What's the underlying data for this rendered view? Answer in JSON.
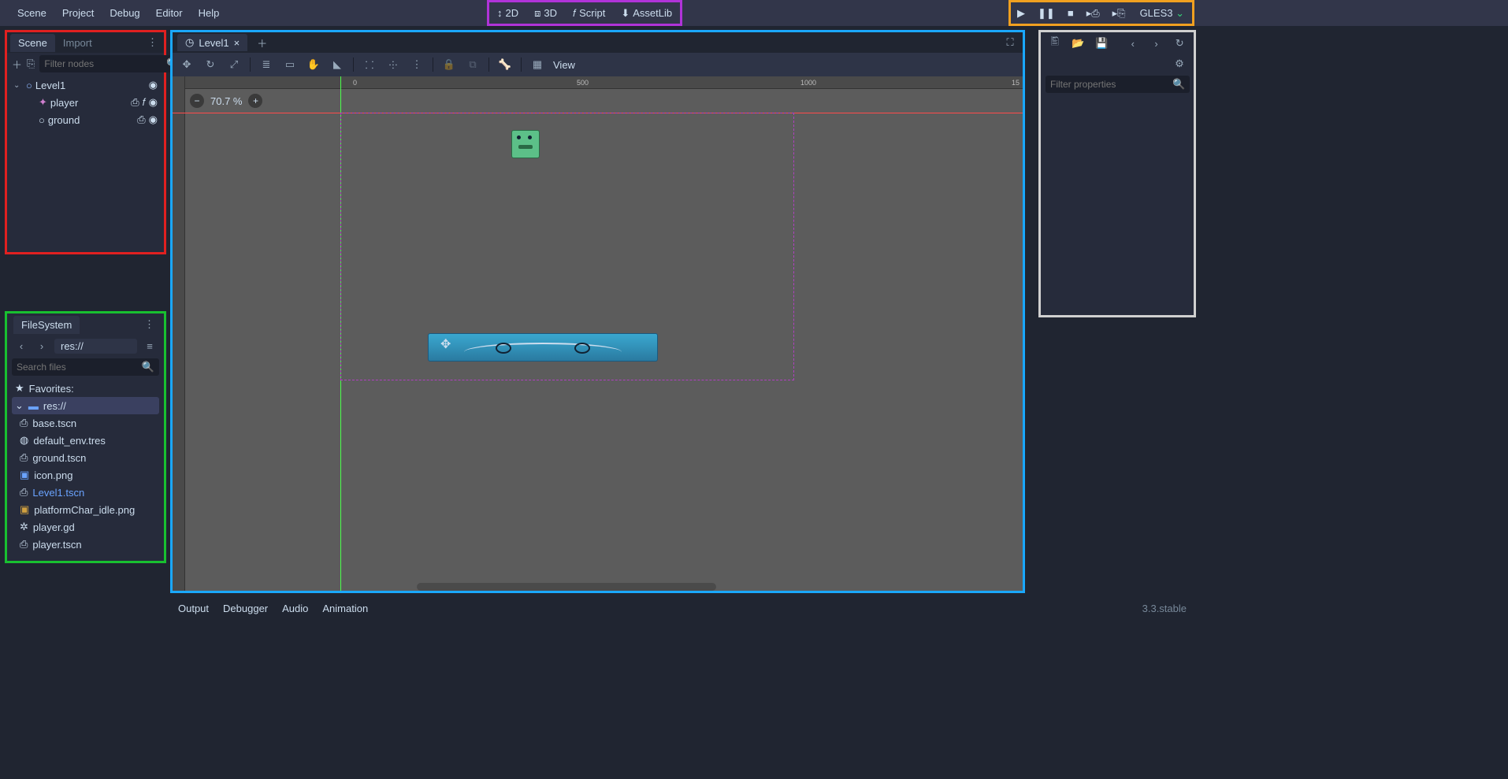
{
  "menubar": {
    "items": [
      "Scene",
      "Project",
      "Debug",
      "Editor",
      "Help"
    ]
  },
  "workspace": {
    "tabs": [
      {
        "label": "2D",
        "icon": "2d-icon",
        "active": true
      },
      {
        "label": "3D",
        "icon": "3d-icon",
        "active": false
      },
      {
        "label": "Script",
        "icon": "script-icon",
        "active": false
      },
      {
        "label": "AssetLib",
        "icon": "assetlib-icon",
        "active": false
      }
    ]
  },
  "playbar": {
    "renderer": "GLES3"
  },
  "scene_dock": {
    "tabs": [
      "Scene",
      "Import"
    ],
    "active_tab": 0,
    "filter_placeholder": "Filter nodes",
    "tree": [
      {
        "name": "Level1",
        "icon": "node2d-icon",
        "depth": 0,
        "expanded": true,
        "buttons": [
          "visibility"
        ]
      },
      {
        "name": "player",
        "icon": "kinematic-icon",
        "depth": 1,
        "buttons": [
          "instance",
          "script",
          "visibility"
        ]
      },
      {
        "name": "ground",
        "icon": "node-icon",
        "depth": 1,
        "buttons": [
          "instance",
          "visibility"
        ]
      }
    ]
  },
  "filesystem_dock": {
    "title": "FileSystem",
    "path": "res://",
    "search_placeholder": "Search files",
    "favorites_label": "Favorites:",
    "root_label": "res://",
    "files": [
      {
        "name": "base.tscn",
        "icon": "scene-file-icon"
      },
      {
        "name": "default_env.tres",
        "icon": "env-file-icon"
      },
      {
        "name": "ground.tscn",
        "icon": "scene-file-icon"
      },
      {
        "name": "icon.png",
        "icon": "image-file-icon"
      },
      {
        "name": "Level1.tscn",
        "icon": "scene-file-icon",
        "highlight": true
      },
      {
        "name": "platformChar_idle.png",
        "icon": "image-file-icon"
      },
      {
        "name": "player.gd",
        "icon": "script-file-icon"
      },
      {
        "name": "player.tscn",
        "icon": "scene-file-icon"
      }
    ]
  },
  "editor": {
    "open_scene": "Level1",
    "zoom": "70.7 %",
    "view_label": "View",
    "ruler_ticks": [
      "0",
      "500",
      "1000",
      "15"
    ]
  },
  "inspector": {
    "filter_placeholder": "Filter properties"
  },
  "bottom_panel": {
    "tabs": [
      "Output",
      "Debugger",
      "Audio",
      "Animation"
    ]
  },
  "version": "3.3.stable"
}
